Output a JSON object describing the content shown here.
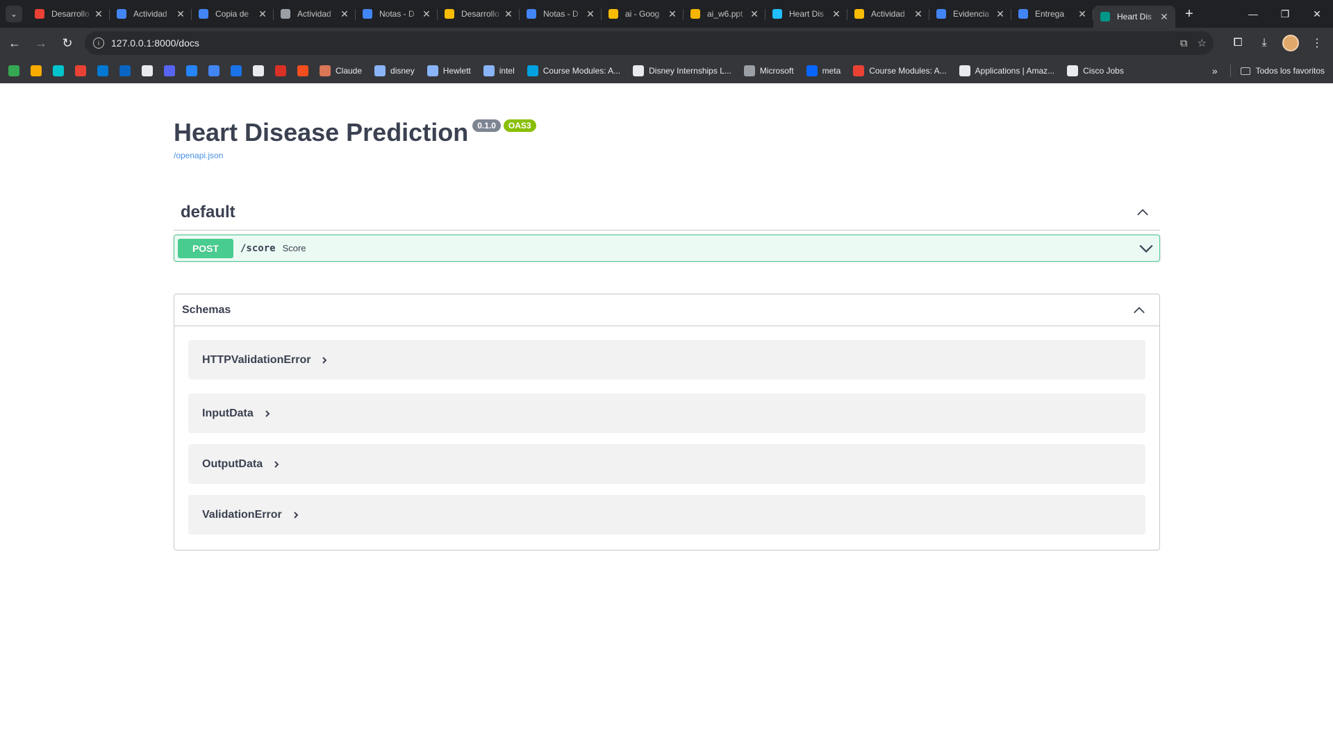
{
  "browser": {
    "tabs": [
      {
        "title": "Desarrollo",
        "icon": "canvas-icon",
        "color": "#e94235"
      },
      {
        "title": "Actividad",
        "icon": "docs-icon",
        "color": "#4285f4"
      },
      {
        "title": "Copia de",
        "icon": "docs-icon",
        "color": "#4285f4"
      },
      {
        "title": "Actividad",
        "icon": "globe-icon",
        "color": "#9aa0a6"
      },
      {
        "title": "Notas - D",
        "icon": "docs-icon",
        "color": "#4285f4"
      },
      {
        "title": "Desarrollo",
        "icon": "drive-icon",
        "color": "#fbbc04"
      },
      {
        "title": "Notas - D",
        "icon": "docs-icon",
        "color": "#4285f4"
      },
      {
        "title": "ai - Goog",
        "icon": "drive-icon",
        "color": "#fbbc04"
      },
      {
        "title": "ai_w6.ppt",
        "icon": "slides-icon",
        "color": "#f4b400"
      },
      {
        "title": "Heart Dis",
        "icon": "kaggle-icon",
        "color": "#20beff"
      },
      {
        "title": "Actividad",
        "icon": "drive-icon",
        "color": "#fbbc04"
      },
      {
        "title": "Evidencia",
        "icon": "docs-icon",
        "color": "#4285f4"
      },
      {
        "title": "Entrega",
        "icon": "docs-icon",
        "color": "#4285f4"
      },
      {
        "title": "Heart Dis",
        "icon": "fastapi-icon",
        "color": "#009688",
        "active": true
      }
    ],
    "url": "127.0.0.1:8000/docs",
    "bookmarks_icons_only": [
      {
        "icon": "drive-icon",
        "color": "#34a853"
      },
      {
        "icon": "chart-icon",
        "color": "#f9ab00"
      },
      {
        "icon": "canva-icon",
        "color": "#00c4cc"
      },
      {
        "icon": "canvas-icon",
        "color": "#e94235"
      },
      {
        "icon": "outlook-icon",
        "color": "#0078d4"
      },
      {
        "icon": "linkedin-icon",
        "color": "#0a66c2"
      },
      {
        "icon": "github-icon",
        "color": "#e8eaed"
      },
      {
        "icon": "discord-icon",
        "color": "#5865f2"
      },
      {
        "icon": "jira-icon",
        "color": "#2684ff"
      },
      {
        "icon": "translate-icon",
        "color": "#4285f4"
      },
      {
        "icon": "app-icon",
        "color": "#1a73e8"
      },
      {
        "icon": "disney-icon",
        "color": "#e8eaed"
      },
      {
        "icon": "gallery-icon",
        "color": "#d93025"
      },
      {
        "icon": "figma-icon",
        "color": "#f24e1e"
      }
    ],
    "bookmarks": [
      {
        "label": "Claude",
        "icon": "claude-icon",
        "color": "#d97757"
      },
      {
        "label": "disney",
        "icon": "headset-icon",
        "color": "#8ab4f8"
      },
      {
        "label": "Hewlett",
        "icon": "headset-icon",
        "color": "#8ab4f8"
      },
      {
        "label": "intel",
        "icon": "headset-icon",
        "color": "#8ab4f8"
      },
      {
        "label": "Course Modules: A...",
        "icon": "salesforce-icon",
        "color": "#00a1e0"
      },
      {
        "label": "Disney Internships L...",
        "icon": "disney-icon",
        "color": "#e8eaed"
      },
      {
        "label": "Microsoft",
        "icon": "globe-icon",
        "color": "#9aa0a6"
      },
      {
        "label": "meta",
        "icon": "meta-icon",
        "color": "#0866ff"
      },
      {
        "label": "Course Modules: A...",
        "icon": "canvas-icon",
        "color": "#e94235"
      },
      {
        "label": "Applications | Amaz...",
        "icon": "amazon-icon",
        "color": "#e8eaed"
      },
      {
        "label": "Cisco Jobs",
        "icon": "cisco-icon",
        "color": "#e8eaed"
      }
    ],
    "all_bookmarks_label": "Todos los favoritos"
  },
  "swagger": {
    "title": "Heart Disease Prediction",
    "version": "0.1.0",
    "oas": "OAS3",
    "spec_link": "/openapi.json",
    "tag": "default",
    "operation": {
      "method": "POST",
      "path": "/score",
      "summary": "Score"
    },
    "schemas_title": "Schemas",
    "schemas": [
      "HTTPValidationError",
      "InputData",
      "OutputData",
      "ValidationError"
    ]
  },
  "colors": {
    "post": "#49cc90",
    "text": "#3b4151",
    "link": "#4990e2",
    "version_badge": "#7d8492",
    "oas_badge": "#89bf04"
  }
}
